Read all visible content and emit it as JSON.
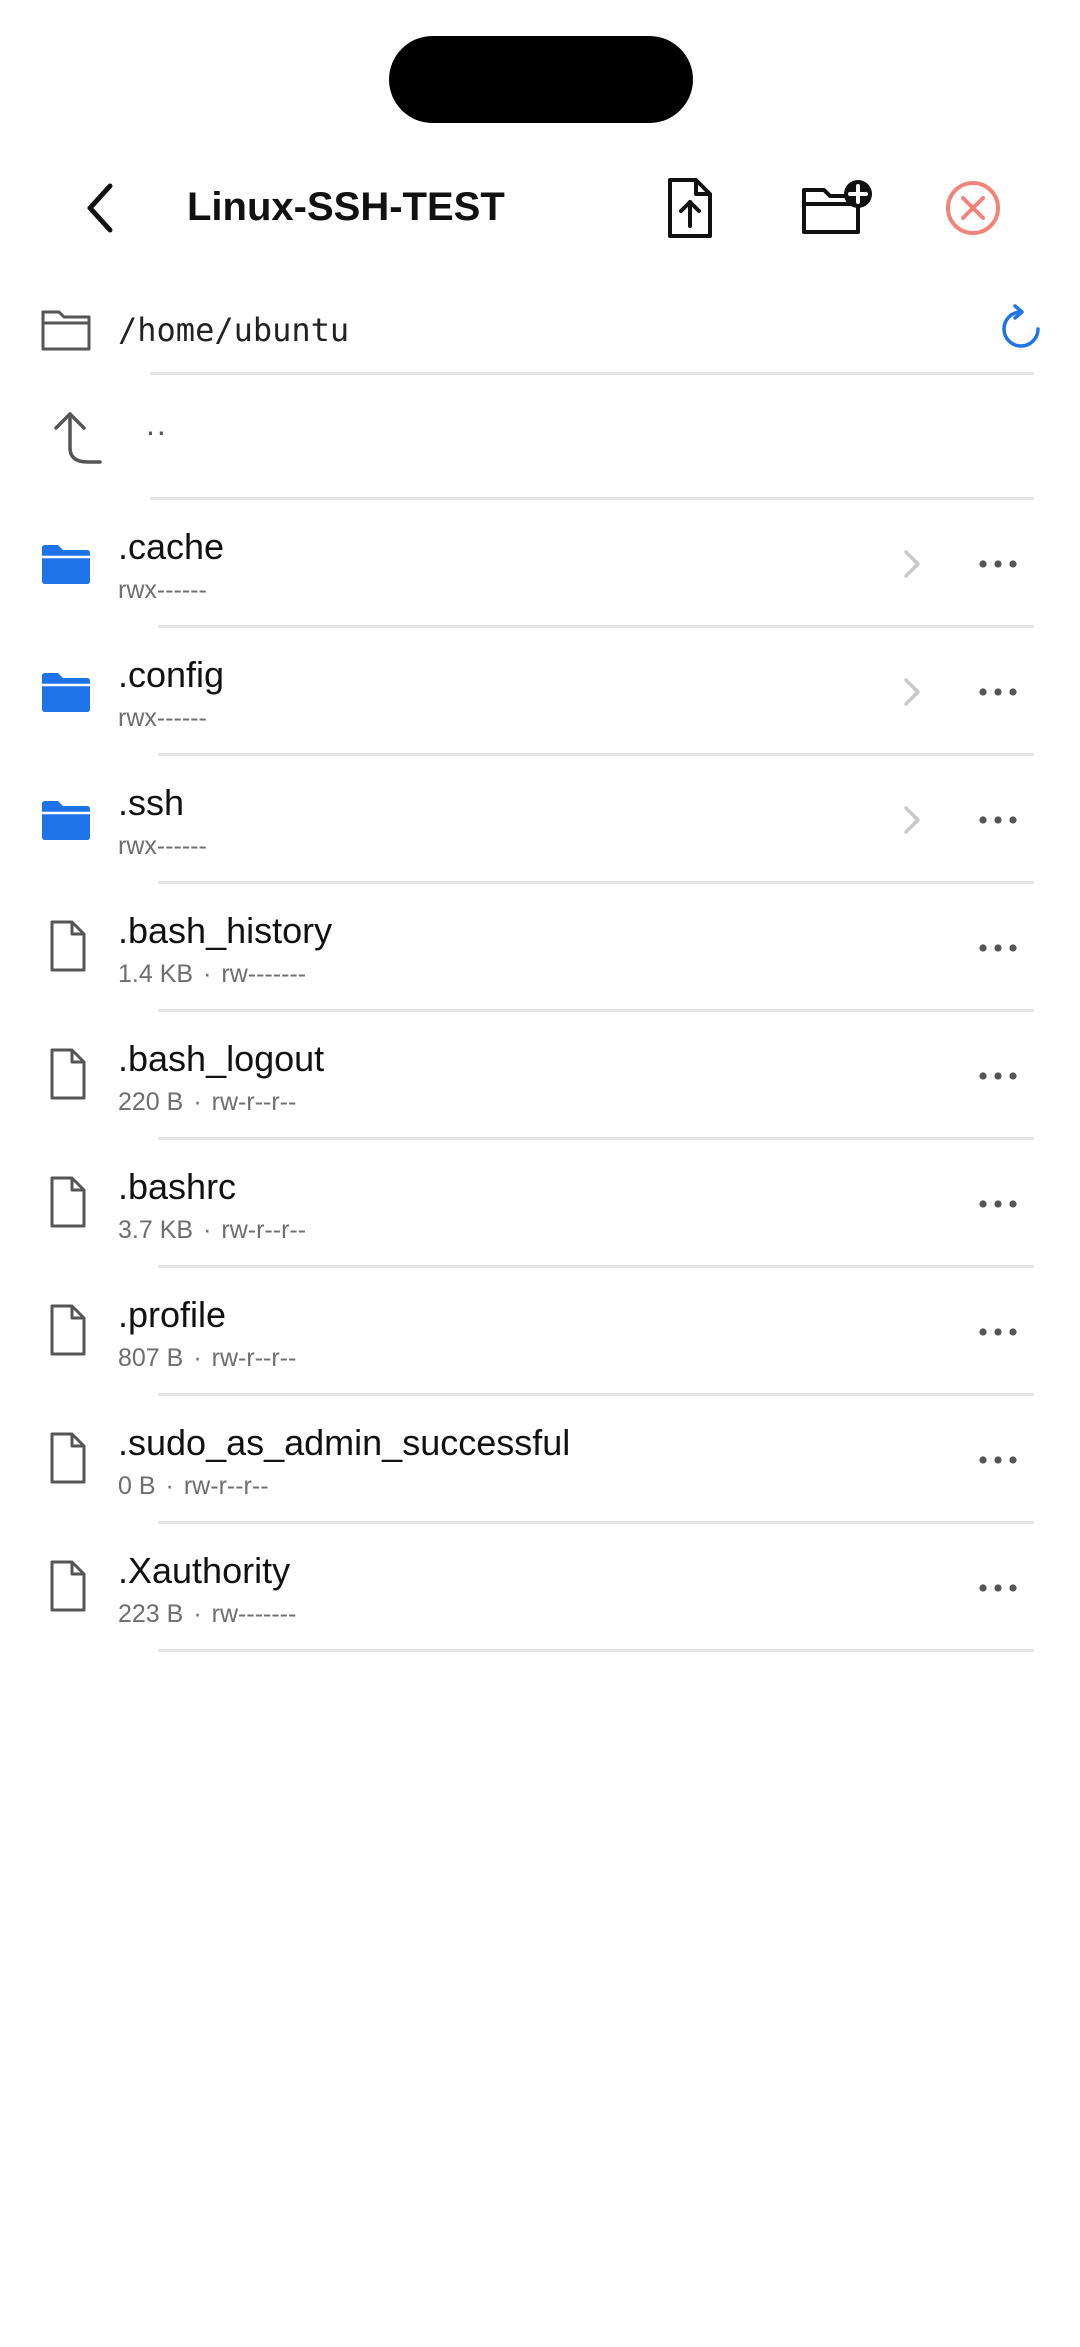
{
  "header": {
    "title": "Linux-SSH-TEST",
    "back_icon": "chevron-left-icon",
    "upload_icon": "file-upload-icon",
    "new_folder_icon": "folder-plus-icon",
    "close_icon": "close-circle-icon"
  },
  "path": {
    "current": "/home/ubuntu",
    "icon": "folder-outline-icon",
    "refresh_icon": "refresh-icon"
  },
  "parent": {
    "label": "..",
    "icon": "arrow-up-left-icon"
  },
  "items": [
    {
      "name": ".cache",
      "type": "folder",
      "size": "",
      "perms": "rwx------"
    },
    {
      "name": ".config",
      "type": "folder",
      "size": "",
      "perms": "rwx------"
    },
    {
      "name": ".ssh",
      "type": "folder",
      "size": "",
      "perms": "rwx------"
    },
    {
      "name": ".bash_history",
      "type": "file",
      "size": "1.4 KB",
      "perms": "rw-------"
    },
    {
      "name": ".bash_logout",
      "type": "file",
      "size": "220 B",
      "perms": "rw-r--r--"
    },
    {
      "name": ".bashrc",
      "type": "file",
      "size": "3.7 KB",
      "perms": "rw-r--r--"
    },
    {
      "name": ".profile",
      "type": "file",
      "size": "807 B",
      "perms": "rw-r--r--"
    },
    {
      "name": ".sudo_as_admin_successful",
      "type": "file",
      "size": "0 B",
      "perms": "rw-r--r--"
    },
    {
      "name": ".Xauthority",
      "type": "file",
      "size": "223 B",
      "perms": "rw-------"
    }
  ],
  "colors": {
    "folder": "#1e73e8",
    "accent": "#1e73e8",
    "close": "#f0837c",
    "icon_gray": "#555555",
    "meta_gray": "#6e6e6e",
    "separator": "#e4e4e4"
  }
}
